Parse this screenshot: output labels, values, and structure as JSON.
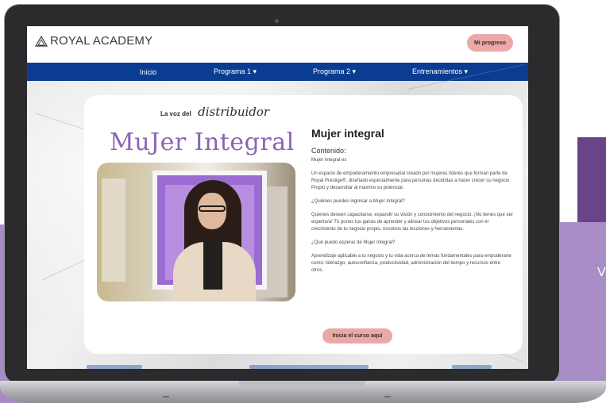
{
  "site": {
    "logo_text": "ROYAL ACADEMY",
    "progress_button": "Mi progreso"
  },
  "nav": {
    "items": [
      {
        "label": "Inicio"
      },
      {
        "label": "Programa 1 ▾"
      },
      {
        "label": "Programa 2 ▾"
      },
      {
        "label": "Entrenamientos ▾"
      }
    ]
  },
  "course": {
    "image_header_small": "La voz del",
    "image_header_script": "distribuidor",
    "image_title": "MuJer Integral",
    "title": "Mujer integral",
    "contenido_label": "Contenido:",
    "intro": "Mujer integral es",
    "paragraphs": [
      "Un espacio de empoderamiento empresarial creado por mujeres líderes que forman parte de Royal Prestige®, diseñado especialmente para personas decididas a hacer crecer su negocio Propio y desarrollar al máximo su potencial.",
      "¿Quiénes pueden ingresar a Mujer Integral?",
      "Quienes deseen capacitarse, expandir su visión y conocimiento del negocio. ¡No tienes que ser experto/a! Tú pones tus ganas de aprender y alinear tus objetivos personales con el crecimiento de tu negocio propio, nosotros las lecciones y herramientas.",
      "¿Qué puedo esperar de Mujer Integral?",
      "Aprendizaje aplicable a tu negocio y tu vida acerca de temas fundamentales para empoderarte como: liderazgo, autoconfianza, productividad, administración del tiempo y recursos entre otros."
    ],
    "cta_button": "Inicia el curso aquí"
  },
  "background": {
    "side_text": "V"
  },
  "colors": {
    "nav_bg": "#0a3d91",
    "button_pink": "#eaa9a7",
    "accent_purple": "#8a64b4"
  }
}
